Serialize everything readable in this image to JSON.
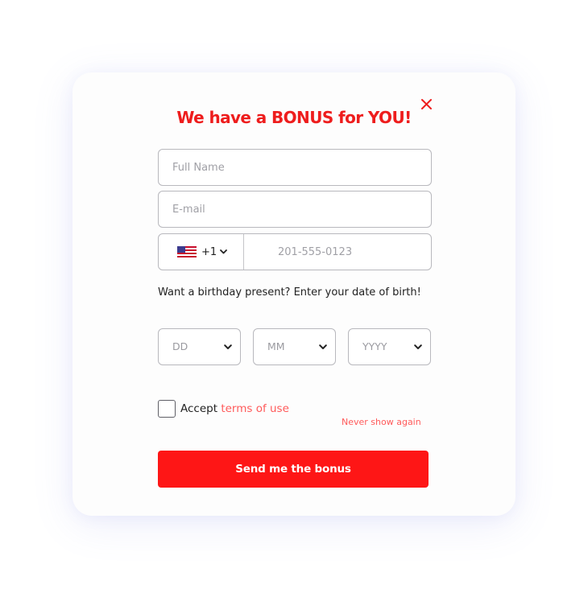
{
  "modal": {
    "title": "We have a BONUS for YOU!",
    "close_icon": "close-icon",
    "accent_color": "#ee1d1d"
  },
  "form": {
    "full_name": {
      "placeholder": "Full Name",
      "value": ""
    },
    "email": {
      "placeholder": "E-mail",
      "value": ""
    },
    "phone": {
      "country_flag": "us-flag-icon",
      "country_code": "+1",
      "placeholder": "201-555-0123",
      "value": ""
    },
    "birthday_prompt": "Want a birthday present? Enter your date of birth!",
    "birth_date": {
      "day": "DD",
      "month": "MM",
      "year": "YYYY"
    },
    "accept_prefix": "Accept",
    "accept_link": "terms of use",
    "accepted": false,
    "never_show_again": "Never show again",
    "submit_label": "Send me the bonus"
  }
}
